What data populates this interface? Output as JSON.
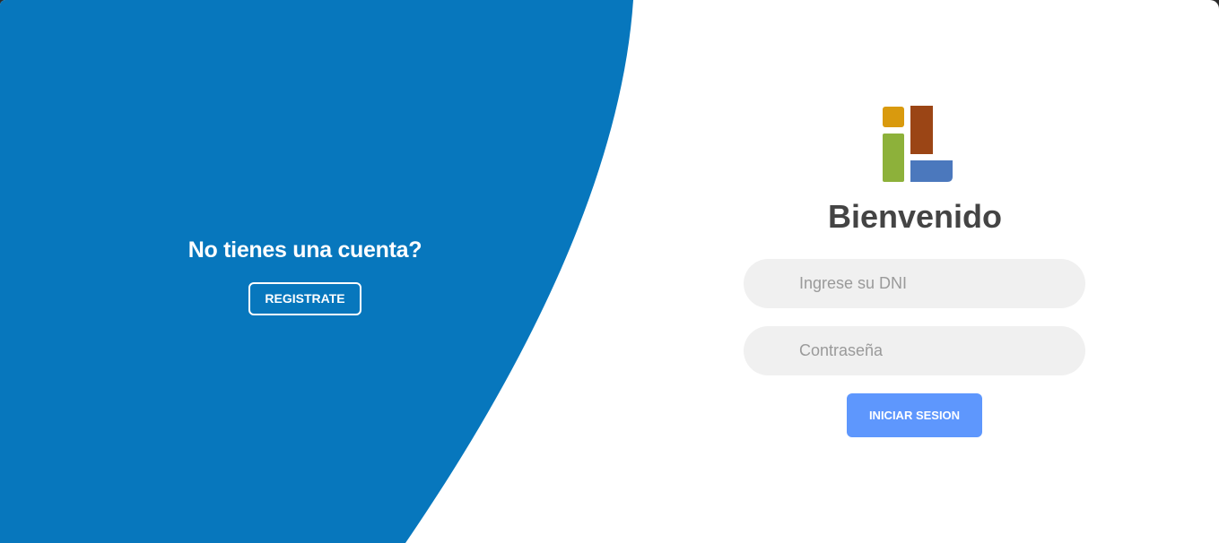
{
  "left_panel": {
    "title": "No tienes una cuenta?",
    "register_label": "REGISTRATE"
  },
  "login": {
    "welcome": "Bienvenido",
    "dni_placeholder": "Ingrese su DNI",
    "password_placeholder": "Contraseña",
    "submit_label": "INICIAR SESION"
  },
  "colors": {
    "panel_blue": "#0777bd",
    "button_blue": "#5e97fd",
    "logo_yellow": "#d99a0e",
    "logo_green": "#8db13a",
    "logo_brown": "#9b4515",
    "logo_blue": "#4b78bd"
  },
  "icons": {
    "logo": "il-logo-icon"
  }
}
